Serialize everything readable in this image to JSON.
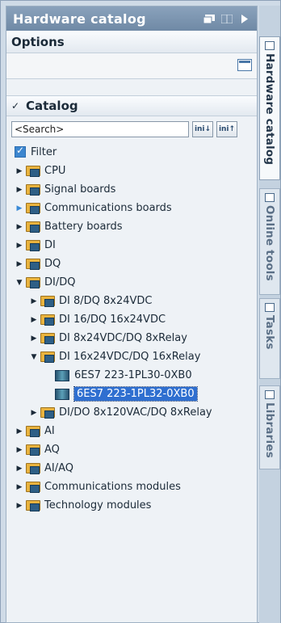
{
  "panel": {
    "title": "Hardware catalog",
    "options_label": "Options",
    "catalog_label": "Catalog",
    "search": {
      "value": "<Search>"
    },
    "search_buttons": [
      "ini↓",
      "ini↑"
    ],
    "filter_label": "Filter",
    "tree": [
      {
        "label": "CPU",
        "level": 0,
        "expander": "collapsed"
      },
      {
        "label": "Signal boards",
        "level": 0,
        "expander": "collapsed"
      },
      {
        "label": "Communications boards",
        "level": 0,
        "expander": "collapsed-blue"
      },
      {
        "label": "Battery boards",
        "level": 0,
        "expander": "collapsed"
      },
      {
        "label": "DI",
        "level": 0,
        "expander": "collapsed"
      },
      {
        "label": "DQ",
        "level": 0,
        "expander": "collapsed"
      },
      {
        "label": "DI/DQ",
        "level": 0,
        "expander": "expanded"
      },
      {
        "label": "DI 8/DQ 8x24VDC",
        "level": 1,
        "expander": "collapsed"
      },
      {
        "label": "DI 16/DQ 16x24VDC",
        "level": 1,
        "expander": "collapsed"
      },
      {
        "label": "DI 8x24VDC/DQ 8xRelay",
        "level": 1,
        "expander": "collapsed"
      },
      {
        "label": "DI 16x24VDC/DQ 16xRelay",
        "level": 1,
        "expander": "expanded"
      },
      {
        "label": "6ES7 223-1PL30-0XB0",
        "level": 2,
        "expander": "none",
        "kind": "device"
      },
      {
        "label": "6ES7 223-1PL32-0XB0",
        "level": 2,
        "expander": "none",
        "kind": "device",
        "selected": true
      },
      {
        "label": "DI/DO 8x120VAC/DQ 8xRelay",
        "level": 1,
        "expander": "collapsed"
      },
      {
        "label": "AI",
        "level": 0,
        "expander": "collapsed"
      },
      {
        "label": "AQ",
        "level": 0,
        "expander": "collapsed"
      },
      {
        "label": "AI/AQ",
        "level": 0,
        "expander": "collapsed"
      },
      {
        "label": "Communications modules",
        "level": 0,
        "expander": "collapsed"
      },
      {
        "label": "Technology modules",
        "level": 0,
        "expander": "collapsed"
      }
    ]
  },
  "right_tabs": [
    {
      "label": "Hardware catalog",
      "active": true
    },
    {
      "label": "Online tools",
      "active": false
    },
    {
      "label": "Tasks",
      "active": false
    },
    {
      "label": "Libraries",
      "active": false
    }
  ]
}
